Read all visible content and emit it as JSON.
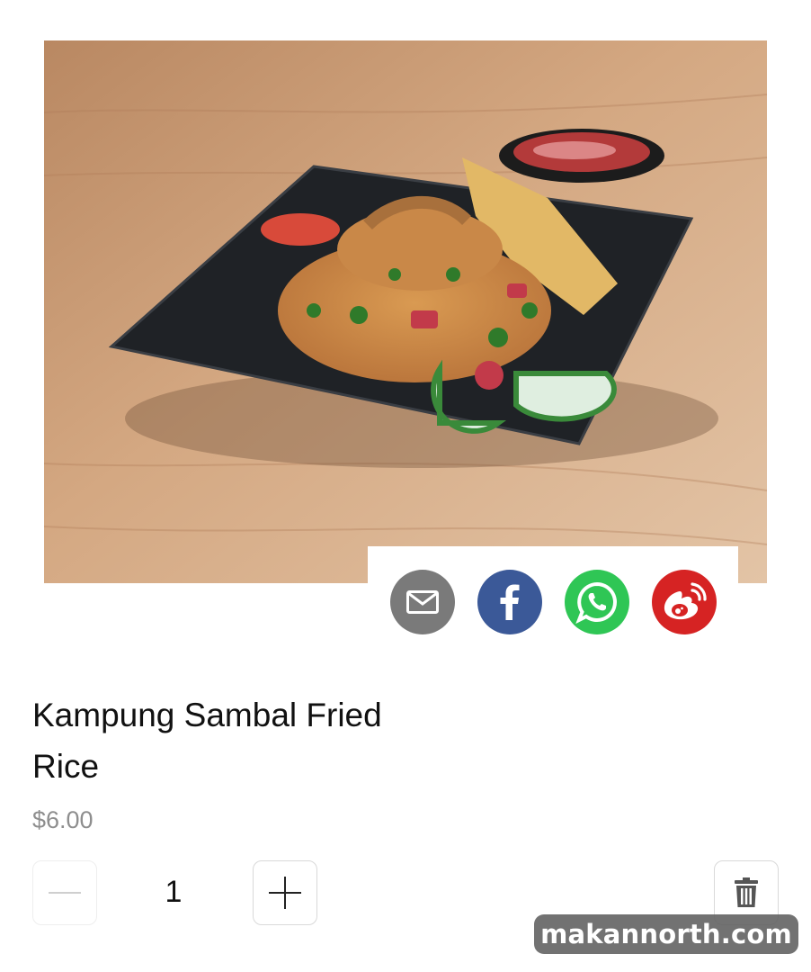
{
  "product": {
    "name": "Kampung Sambal Fried Rice",
    "price": "$6.00",
    "quantity": "1"
  },
  "share": {
    "items": [
      {
        "icon": "mail-icon",
        "color": "#7a7a7a"
      },
      {
        "icon": "facebook-icon",
        "color": "#3b5998"
      },
      {
        "icon": "whatsapp-icon",
        "color": "#2fc655"
      },
      {
        "icon": "weibo-icon",
        "color": "#d62323"
      }
    ]
  },
  "quantity_controls": {
    "decrement_icon": "minus-icon",
    "increment_icon": "plus-icon",
    "delete_icon": "trash-icon"
  },
  "watermark": "makannorth.com"
}
